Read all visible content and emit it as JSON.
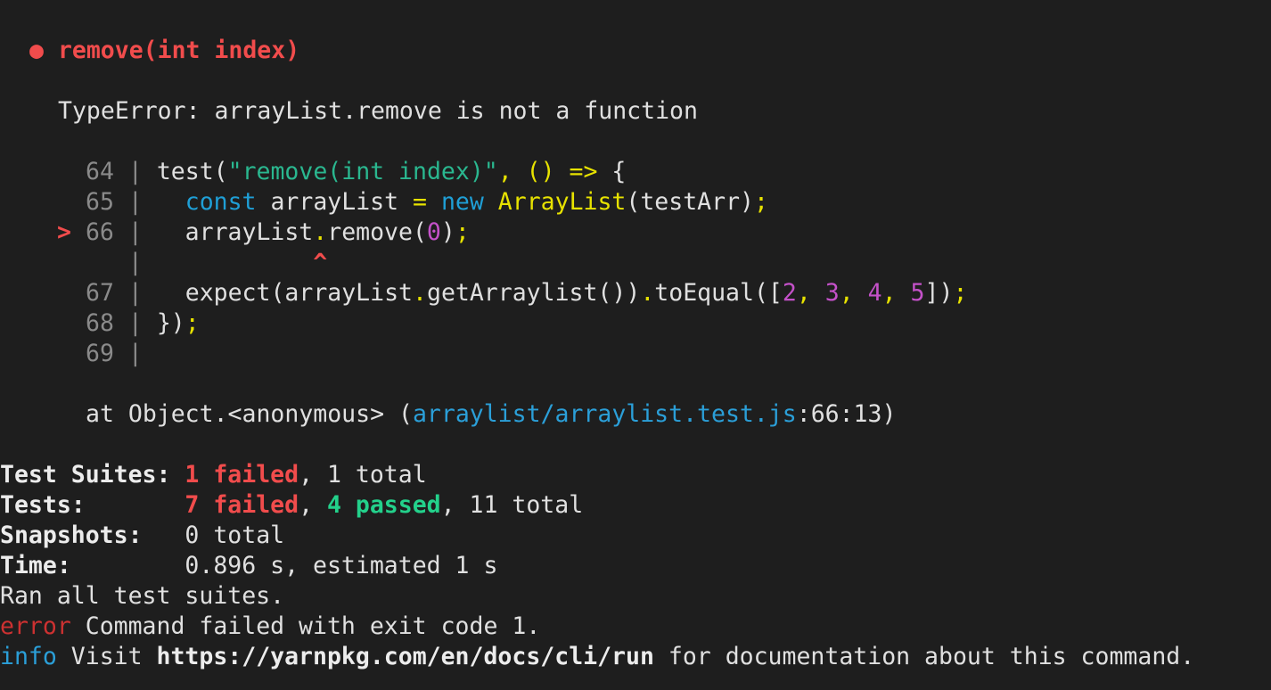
{
  "test_block": {
    "bullet": "●",
    "title": "remove(int index)",
    "error_message": "TypeError: arrayList.remove is not a function"
  },
  "code": {
    "lines": [
      {
        "num": "64",
        "marker": "",
        "text_parts": {
          "p1": "test(",
          "p2": "\"remove(int index)\"",
          "p3": ", () ",
          "p4": "=>",
          "p5": " {"
        }
      },
      {
        "num": "65",
        "marker": "",
        "text_parts": {
          "p1": "const",
          "p2": " arrayList ",
          "p3": "=",
          "p4": " ",
          "p5": "new",
          "p6": " ",
          "p7": "ArrayList",
          "p8": "(testArr)",
          "p9": ";"
        }
      },
      {
        "num": "66",
        "marker": ">",
        "text_parts": {
          "p1": "arrayList",
          "p2": ".",
          "p3": "remove(",
          "p4": "0",
          "p5": ")",
          "p6": ";"
        }
      },
      {
        "num": "",
        "marker": "",
        "caret": "^"
      },
      {
        "num": "67",
        "marker": "",
        "text_parts": {
          "p1": "expect(arrayList",
          "p2": ".",
          "p3": "getArraylist())",
          "p4": ".",
          "p5": "toEqual([",
          "p6": "2",
          "p7": ", ",
          "p8": "3",
          "p9": ", ",
          "p10": "4",
          "p11": ", ",
          "p12": "5",
          "p13": "])",
          "p14": ";"
        }
      },
      {
        "num": "68",
        "marker": "",
        "text_parts": {
          "p1": "})",
          "p2": ";"
        }
      },
      {
        "num": "69",
        "marker": "",
        "text_parts": {}
      }
    ],
    "separator": "|"
  },
  "stack": {
    "prefix": "at Object.<anonymous> (",
    "file": "arraylist/arraylist.test.js",
    "suffix": ":66:13)"
  },
  "summary": {
    "suites_label": "Test Suites:",
    "suites_failed": "1 failed",
    "suites_total": ", 1 total",
    "tests_label": "Tests:",
    "tests_failed": "7 failed",
    "tests_sep": ", ",
    "tests_passed": "4 passed",
    "tests_total": ", 11 total",
    "snapshots_label": "Snapshots:",
    "snapshots_value": "0 total",
    "time_label": "Time:",
    "time_value": "0.896 s, estimated 1 s",
    "ran_all": "Ran all test suites."
  },
  "yarn": {
    "error_word": "error",
    "error_text": " Command failed with exit code 1.",
    "info_word": "info",
    "info_text_1": " Visit ",
    "info_url": "https://yarnpkg.com/en/docs/cli/run",
    "info_text_2": " for documentation about this command."
  },
  "colors": {
    "background": "#1e1e1e",
    "foreground": "#e0e0e0",
    "failed": "#f14c4c",
    "passed": "#23d18b",
    "link": "#2b9fd8",
    "string": "#2ab78f",
    "keyword": "#1f9fd6",
    "class": "#e7e200",
    "number": "#c451c9"
  }
}
